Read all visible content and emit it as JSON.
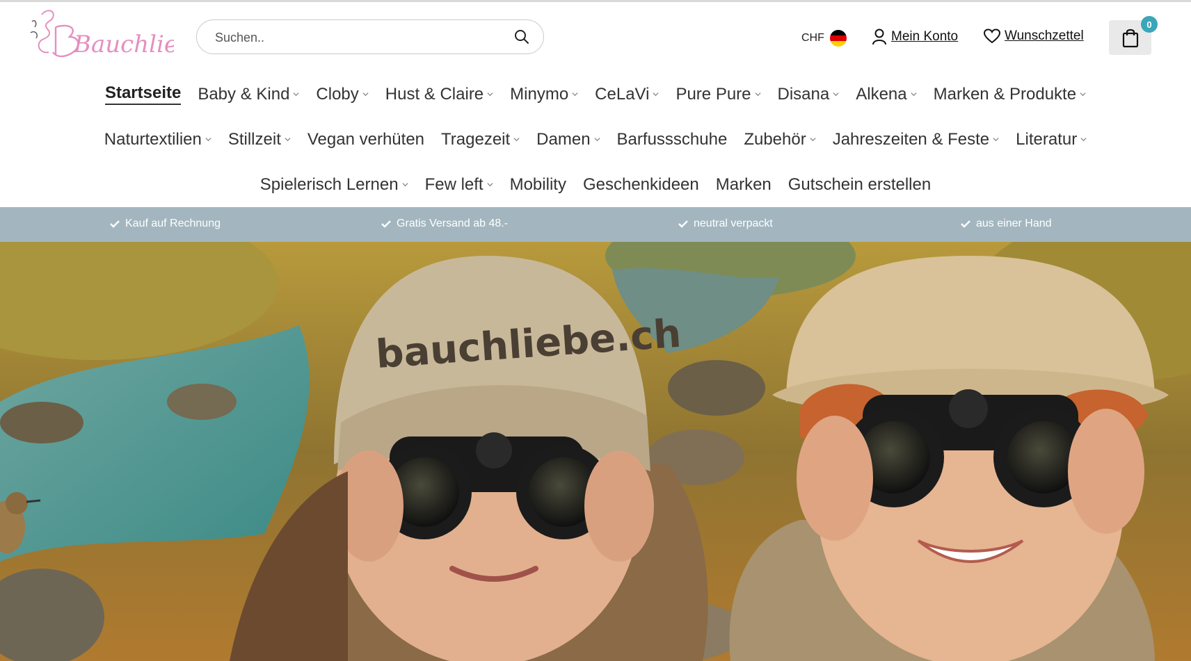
{
  "brand": {
    "logo_text": "Bauchliebe"
  },
  "search": {
    "placeholder": "Suchen.."
  },
  "header": {
    "currency": "CHF",
    "account_label": "Mein Konto",
    "wishlist_label": "Wunschzettel",
    "cart_count": "0"
  },
  "nav": {
    "row1": [
      {
        "label": "Startseite",
        "dropdown": false,
        "active": true
      },
      {
        "label": "Baby & Kind",
        "dropdown": true
      },
      {
        "label": "Cloby",
        "dropdown": true
      },
      {
        "label": "Hust & Claire",
        "dropdown": true
      },
      {
        "label": "Minymo",
        "dropdown": true
      },
      {
        "label": "CeLaVi",
        "dropdown": true
      },
      {
        "label": "Pure Pure",
        "dropdown": true
      },
      {
        "label": "Disana",
        "dropdown": true
      },
      {
        "label": "Alkena",
        "dropdown": true
      },
      {
        "label": "Marken & Produkte",
        "dropdown": true
      }
    ],
    "row2": [
      {
        "label": "Naturtextilien",
        "dropdown": true
      },
      {
        "label": "Stillzeit",
        "dropdown": true
      },
      {
        "label": "Vegan verhüten",
        "dropdown": false
      },
      {
        "label": "Tragezeit",
        "dropdown": true
      },
      {
        "label": "Damen",
        "dropdown": true
      },
      {
        "label": "Barfussschuhe",
        "dropdown": false
      },
      {
        "label": "Zubehör",
        "dropdown": true
      },
      {
        "label": "Jahreszeiten & Feste",
        "dropdown": true
      },
      {
        "label": "Literatur",
        "dropdown": true
      }
    ],
    "row3": [
      {
        "label": "Spielerisch Lernen",
        "dropdown": true
      },
      {
        "label": "Few left",
        "dropdown": true
      },
      {
        "label": "Mobility",
        "dropdown": false
      },
      {
        "label": "Geschenkideen",
        "dropdown": false
      },
      {
        "label": "Marken",
        "dropdown": false
      },
      {
        "label": "Gutschein erstellen",
        "dropdown": false
      }
    ]
  },
  "usp": [
    {
      "label": "Kauf auf Rechnung"
    },
    {
      "label": "Gratis Versand ab 48.-"
    },
    {
      "label": "neutral verpackt"
    },
    {
      "label": "aus einer Hand"
    }
  ],
  "hero": {
    "beanie_text": "bauchliebe.ch"
  },
  "colors": {
    "accent": "#3aa6b9",
    "usp_bar": "#a3b6bf",
    "logo_pink": "#e58fc0"
  },
  "icons": {
    "search": "search-icon",
    "account": "user-icon",
    "wishlist": "heart-icon",
    "cart": "shopping-bag-icon",
    "usp": "check-icon",
    "dropdown": "chevron-down-icon"
  }
}
